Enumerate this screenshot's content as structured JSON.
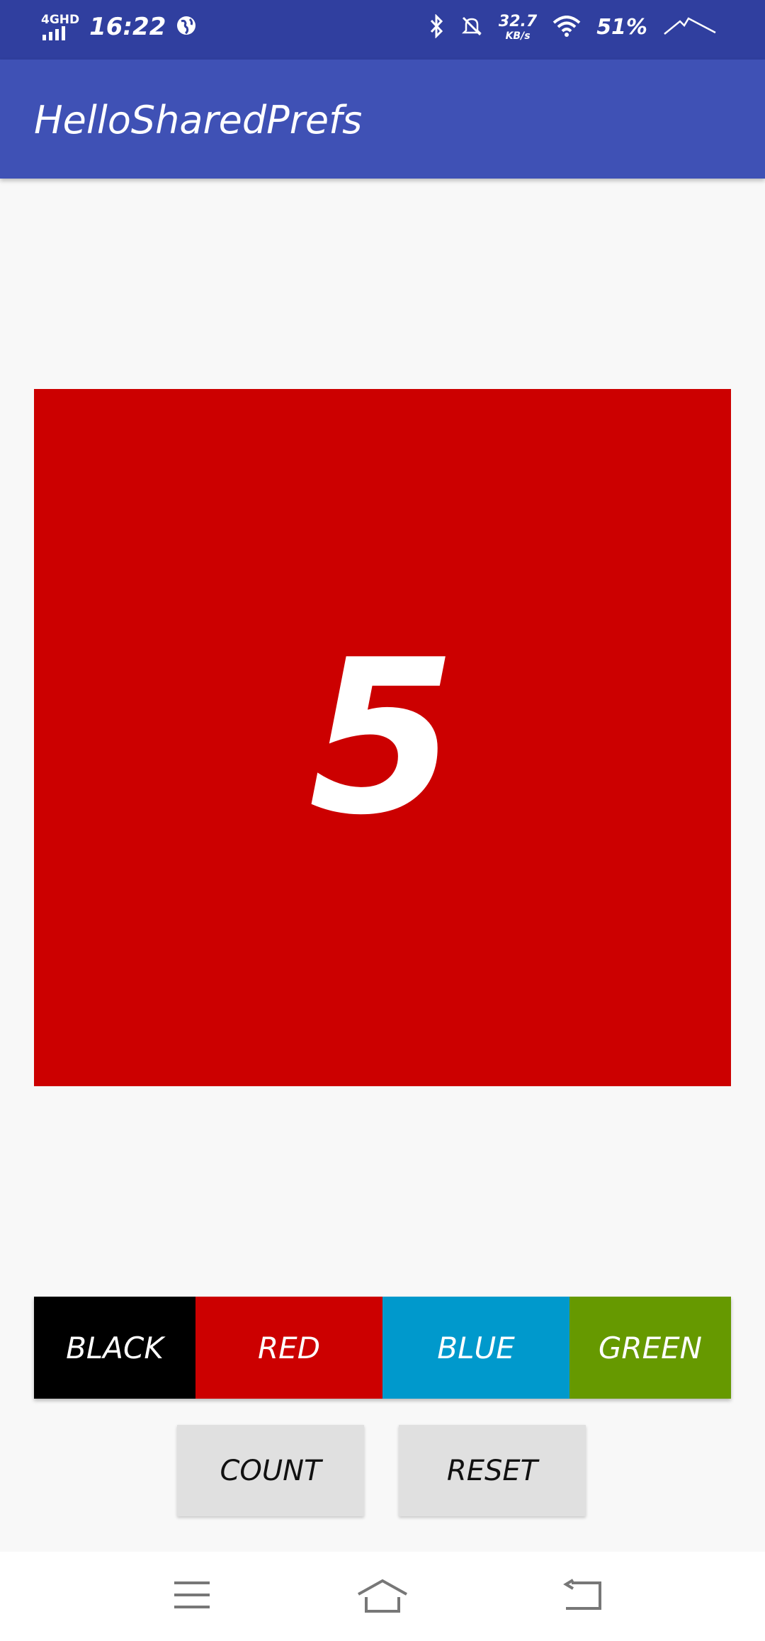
{
  "status_bar": {
    "network": "4GHD",
    "time": "16:22",
    "speed_value": "32.7",
    "speed_unit": "KB/s",
    "battery": "51%"
  },
  "app": {
    "title": "HelloSharedPrefs"
  },
  "counter": {
    "value": "5",
    "background_color": "#cc0000"
  },
  "color_buttons": [
    {
      "label": "BLACK",
      "color": "#000000"
    },
    {
      "label": "RED",
      "color": "#cc0000"
    },
    {
      "label": "BLUE",
      "color": "#0099cc"
    },
    {
      "label": "GREEN",
      "color": "#669900"
    }
  ],
  "actions": {
    "count_label": "COUNT",
    "reset_label": "RESET"
  },
  "nav_icons": [
    "menu-icon",
    "home-icon",
    "back-icon"
  ]
}
